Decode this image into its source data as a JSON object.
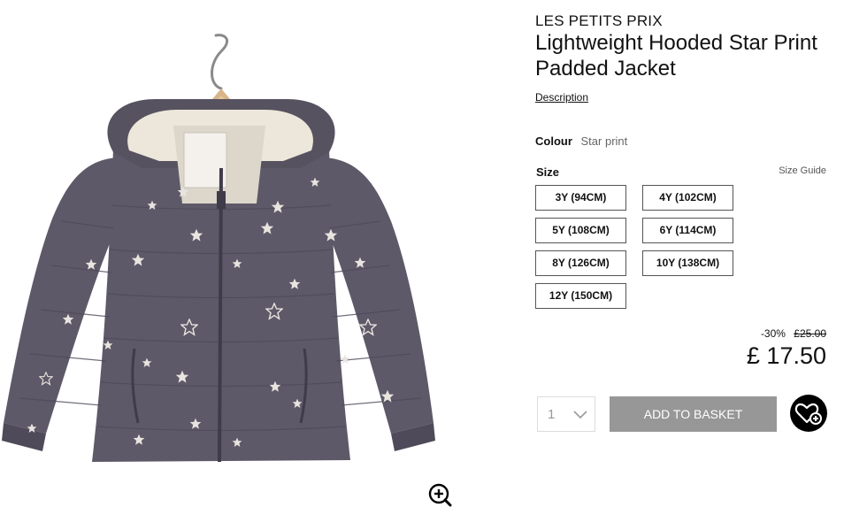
{
  "product": {
    "brand": "LES PETITS PRIX",
    "title": "Lightweight Hooded Star Print Padded Jacket",
    "description_link": "Description"
  },
  "colour": {
    "label": "Colour",
    "value": "Star print"
  },
  "size": {
    "label": "Size",
    "guide_label": "Size Guide",
    "options": [
      "3Y (94CM)",
      "4Y (102CM)",
      "5Y (108CM)",
      "6Y (114CM)",
      "8Y (126CM)",
      "10Y (138CM)",
      "12Y (150CM)"
    ]
  },
  "pricing": {
    "discount": "-30%",
    "old_price": "£25.00",
    "price": "£ 17.50"
  },
  "purchase": {
    "quantity": "1",
    "add_to_basket_label": "ADD TO BASKET"
  },
  "icons": {
    "zoom": "zoom-in-icon",
    "wishlist": "heart-plus-icon",
    "quantity": "chevron-down-icon"
  },
  "colors": {
    "button_grey": "#979797",
    "jacket": "#5e5968",
    "lining": "#ece7da"
  }
}
